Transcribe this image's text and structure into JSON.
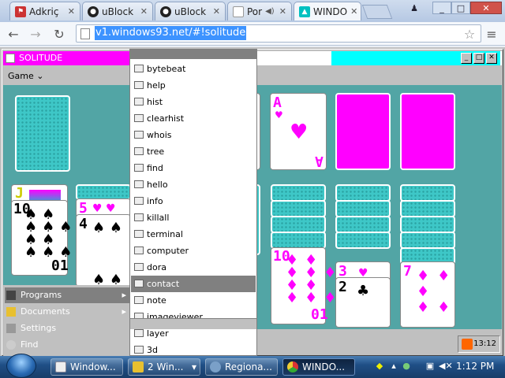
{
  "browser": {
    "tabs": [
      {
        "label": "Adkriç",
        "icon": "flag-icon"
      },
      {
        "label": "uBlock",
        "icon": "github-icon"
      },
      {
        "label": "uBlock",
        "icon": "github-icon"
      },
      {
        "label": "Por",
        "icon": "page-icon"
      },
      {
        "label": "WINDO",
        "icon": "w93-icon"
      }
    ],
    "url": "v1.windows93.net/#!solitude",
    "window_controls": [
      "_",
      "□",
      "✕"
    ]
  },
  "app": {
    "title": "SOLITUDE",
    "menu": [
      "Game"
    ],
    "window_buttons": [
      "_",
      "□",
      "✕"
    ]
  },
  "cards": {
    "jack": "J",
    "tableau1_rank": "10",
    "tableau1_rank_bottom": "01",
    "tableau2_top": "5",
    "tableau2_rank": "4",
    "hearts_ace": "A",
    "diamond_ten": "10",
    "diamond_ten_bottom": "01",
    "three": "3",
    "two": "2",
    "seven": "7"
  },
  "start_menu": {
    "items": [
      {
        "label": "Programs",
        "arrow": "▸",
        "highlight": true
      },
      {
        "label": "Documents",
        "arrow": "▸",
        "highlight": false
      },
      {
        "label": "Settings",
        "arrow": "",
        "highlight": false
      },
      {
        "label": "Find",
        "arrow": "",
        "highlight": false
      }
    ],
    "programs": [
      "bytebeat",
      "help",
      "hist",
      "clearhist",
      "whois",
      "tree",
      "find",
      "hello",
      "info",
      "killall",
      "terminal",
      "computer",
      "dora",
      "contact",
      "note",
      "imageviewer",
      "layer",
      "3d"
    ],
    "highlighted_program": "contact"
  },
  "w93_tray_time": "13:12",
  "taskbar": {
    "items": [
      {
        "label": "Window...",
        "active": false
      },
      {
        "label": "2 Win...",
        "active": false
      },
      {
        "label": "Regiona...",
        "active": false
      },
      {
        "label": "WINDO...",
        "active": true
      }
    ],
    "clock": "1:12 PM"
  },
  "colors": {
    "magenta": "#ff00ff",
    "cyan": "#00ffff",
    "felt": "#52a5a5"
  }
}
